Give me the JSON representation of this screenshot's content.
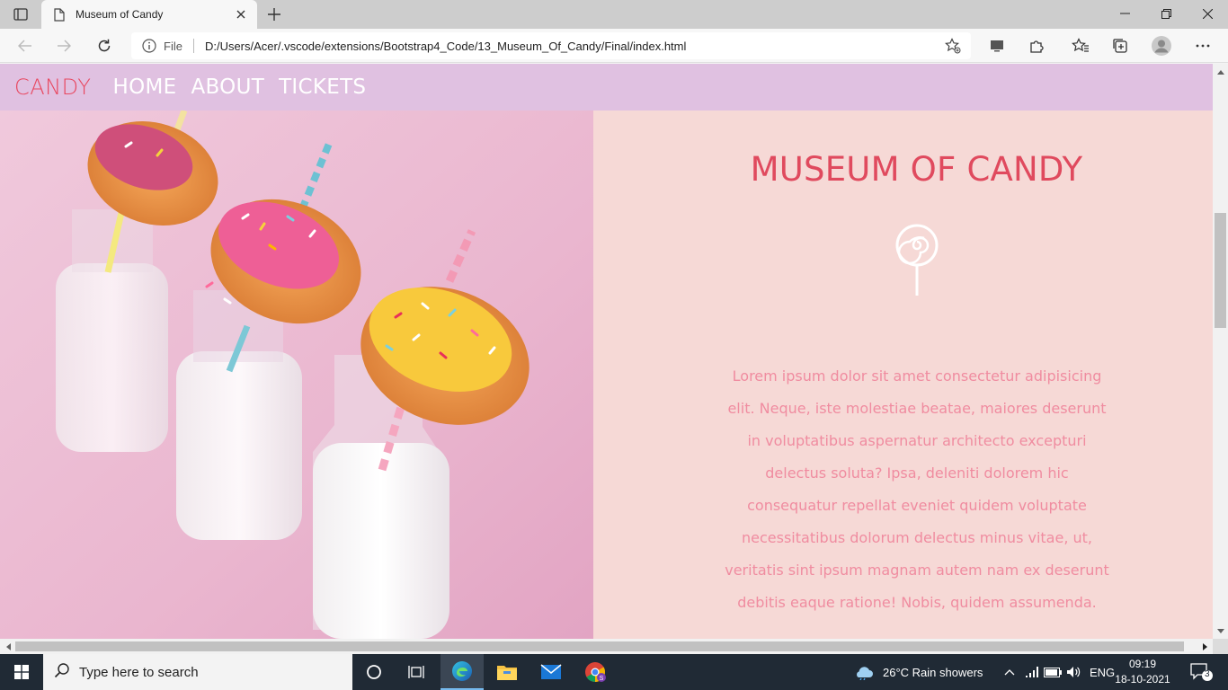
{
  "browser": {
    "tab_title": "Museum of Candy",
    "address_label": "File",
    "url": "D:/Users/Acer/.vscode/extensions/Bootstrap4_Code/13_Museum_Of_Candy/Final/index.html"
  },
  "page": {
    "nav": {
      "brand": "CANDY",
      "links": [
        "HOME",
        "ABOUT",
        "TICKETS"
      ]
    },
    "heading": "MUSEUM OF CANDY",
    "body_text": "Lorem ipsum dolor sit amet consectetur adipisicing elit. Neque, iste molestiae beatae, maiores deserunt in voluptatibus aspernatur architecto excepturi delectus soluta? Ipsa, deleniti dolorem hic consequatur repellat eveniet quidem voluptate necessitatibus dolorum delectus minus vitae, ut, veritatis sint ipsum magnam autem nam ex deserunt debitis eaque ratione! Nobis, quidem assumenda.",
    "colors": {
      "navbar_bg": "#e0c1e1",
      "brand": "#e8475f",
      "heading": "#e04a5e",
      "body_text": "#f08ca0",
      "content_bg": "#f6d9d6"
    }
  },
  "taskbar": {
    "search_placeholder": "Type here to search",
    "weather": "26°C  Rain showers",
    "language": "ENG",
    "time": "09:19",
    "date": "18-10-2021",
    "notification_count": "3"
  }
}
